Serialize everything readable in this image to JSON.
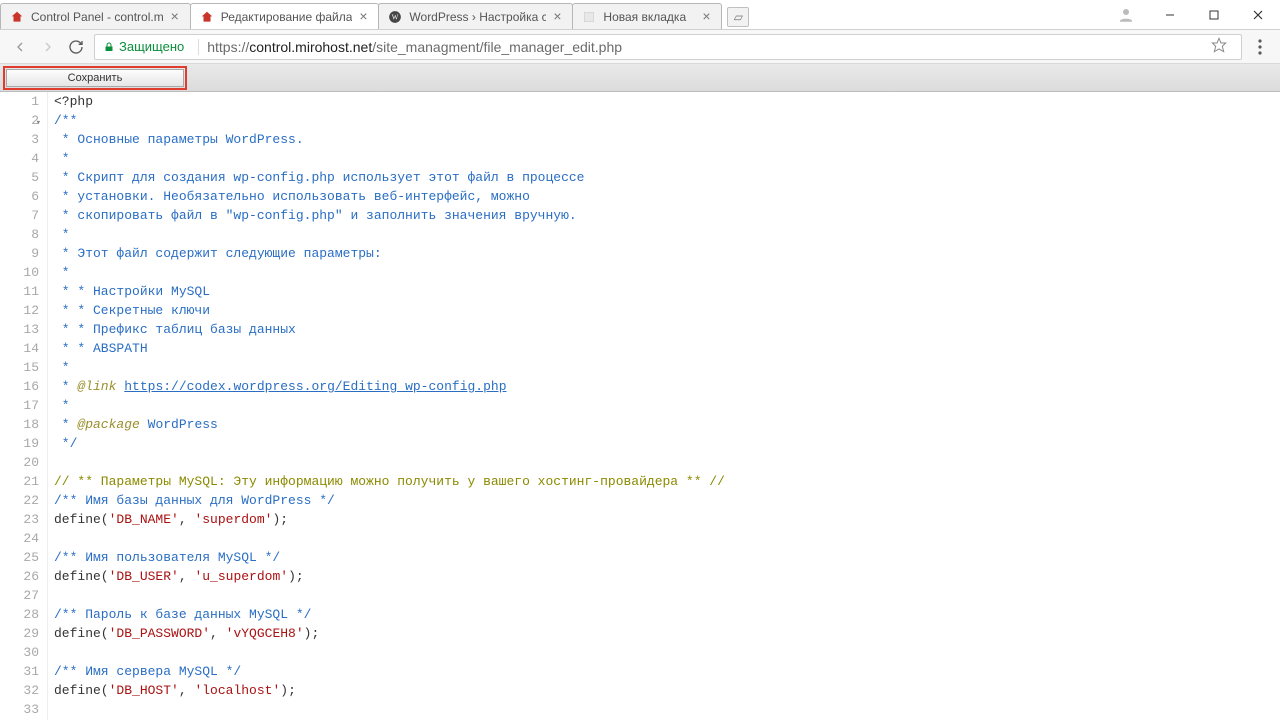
{
  "browser": {
    "tabs": [
      {
        "title": "Control Panel - control.m",
        "favicon": "house-red"
      },
      {
        "title": "Редактирование файла",
        "favicon": "house-red",
        "active": true
      },
      {
        "title": "WordPress › Настройка с",
        "favicon": "wp"
      },
      {
        "title": "Новая вкладка",
        "favicon": "blank"
      }
    ],
    "secure_label": "Защищено",
    "url_scheme": "https://",
    "url_domain": "control.mirohost.net",
    "url_path": "/site_managment/file_manager_edit.php"
  },
  "toolbar": {
    "save_label": "Сохранить"
  },
  "code_lines": [
    {
      "n": 1,
      "html": "&lt;?php",
      "cls": "c-fn"
    },
    {
      "n": 2,
      "html": "/**",
      "cls": "c-cm",
      "fold": true
    },
    {
      "n": 3,
      "html": " * Основные параметры WordPress.",
      "cls": "c-cm"
    },
    {
      "n": 4,
      "html": " *",
      "cls": "c-cm"
    },
    {
      "n": 5,
      "html": " * Скрипт для создания wp-config.php использует этот файл в процессе",
      "cls": "c-cm"
    },
    {
      "n": 6,
      "html": " * установки. Необязательно использовать веб-интерфейс, можно",
      "cls": "c-cm"
    },
    {
      "n": 7,
      "html": " * скопировать файл в \"wp-config.php\" и заполнить значения вручную.",
      "cls": "c-cm"
    },
    {
      "n": 8,
      "html": " *",
      "cls": "c-cm"
    },
    {
      "n": 9,
      "html": " * Этот файл содержит следующие параметры:",
      "cls": "c-cm"
    },
    {
      "n": 10,
      "html": " *",
      "cls": "c-cm"
    },
    {
      "n": 11,
      "html": " * * Настройки MySQL",
      "cls": "c-cm"
    },
    {
      "n": 12,
      "html": " * * Секретные ключи",
      "cls": "c-cm"
    },
    {
      "n": 13,
      "html": " * * Префикс таблиц базы данных",
      "cls": "c-cm"
    },
    {
      "n": 14,
      "html": " * * ABSPATH",
      "cls": "c-cm"
    },
    {
      "n": 15,
      "html": " *",
      "cls": "c-cm"
    },
    {
      "n": 16,
      "html": " * <span class=\"c-tag\">@link</span> <span class=\"c-ln\">https://codex.wordpress.org/Editing_wp-config.php</span>",
      "cls": "c-cm"
    },
    {
      "n": 17,
      "html": " *",
      "cls": "c-cm"
    },
    {
      "n": 18,
      "html": " * <span class=\"c-tag\">@package</span> <span class=\"c-cm\">WordPress</span>",
      "cls": "c-cm"
    },
    {
      "n": 19,
      "html": " */",
      "cls": "c-cm"
    },
    {
      "n": 20,
      "html": "",
      "cls": ""
    },
    {
      "n": 21,
      "html": "<span class=\"c-lc\">// ** Параметры MySQL: Эту информацию можно получить у вашего хостинг-провайдера ** //</span>",
      "cls": ""
    },
    {
      "n": 22,
      "html": "<span class=\"c-cm\">/** Имя базы данных для WordPress */</span>",
      "cls": ""
    },
    {
      "n": 23,
      "html": "define(<span class=\"c-str\">'DB_NAME'</span>, <span class=\"c-str\">'superdom'</span>);",
      "cls": ""
    },
    {
      "n": 24,
      "html": "",
      "cls": ""
    },
    {
      "n": 25,
      "html": "<span class=\"c-cm\">/** Имя пользователя MySQL */</span>",
      "cls": ""
    },
    {
      "n": 26,
      "html": "define(<span class=\"c-str\">'DB_USER'</span>, <span class=\"c-str\">'u_superdom'</span>);",
      "cls": ""
    },
    {
      "n": 27,
      "html": "",
      "cls": ""
    },
    {
      "n": 28,
      "html": "<span class=\"c-cm\">/** Пароль к базе данных MySQL */</span>",
      "cls": ""
    },
    {
      "n": 29,
      "html": "define(<span class=\"c-str\">'DB_PASSWORD'</span>, <span class=\"c-str\">'vYQGCEH8'</span>);",
      "cls": ""
    },
    {
      "n": 30,
      "html": "",
      "cls": ""
    },
    {
      "n": 31,
      "html": "<span class=\"c-cm\">/** Имя сервера MySQL */</span>",
      "cls": ""
    },
    {
      "n": 32,
      "html": "define(<span class=\"c-str\">'DB_HOST'</span>, <span class=\"c-str\">'localhost'</span>);",
      "cls": ""
    },
    {
      "n": 33,
      "html": "",
      "cls": ""
    }
  ]
}
